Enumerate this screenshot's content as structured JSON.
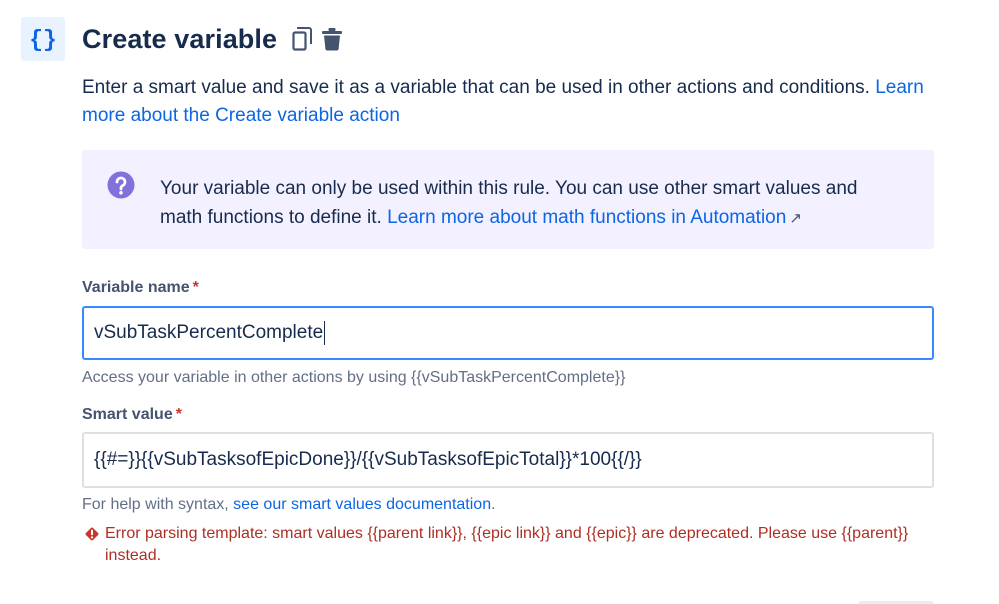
{
  "header": {
    "braces_glyph": "{}",
    "title": "Create variable",
    "copy_icon": "copy-icon",
    "delete_icon": "trash-icon"
  },
  "description": {
    "text": "Enter a smart value and save it as a variable that can be used in other actions and conditions. ",
    "link": "Learn more about the Create variable action"
  },
  "info": {
    "text": "Your variable can only be used within this rule. You can use other smart values and math functions to define it. ",
    "link": "Learn more about math functions in Automation",
    "link_arrow": "↗",
    "icon": "question-circle-icon"
  },
  "variable_name": {
    "label": "Variable name",
    "required_mark": "*",
    "value": "vSubTaskPercentComplete",
    "helper": "Access your variable in other actions by using {{vSubTaskPercentComplete}}"
  },
  "smart_value": {
    "label": "Smart value",
    "required_mark": "*",
    "value": "{{#=}}{{vSubTasksofEpicDone}}/{{vSubTasksofEpicTotal}}*100{{/}}",
    "helper_prefix": "For help with syntax, ",
    "helper_link": "see our smart values documentation",
    "helper_suffix": ".",
    "error": "Error parsing template: smart values {{parent link}}, {{epic link}} and {{epic}} are deprecated. Please use {{parent}} instead."
  },
  "colors": {
    "accent": "#0c66e4",
    "info_bg": "#f3f0ff",
    "info_icon": "#8270db",
    "error": "#ae2e24",
    "focus_border": "#388bff"
  }
}
